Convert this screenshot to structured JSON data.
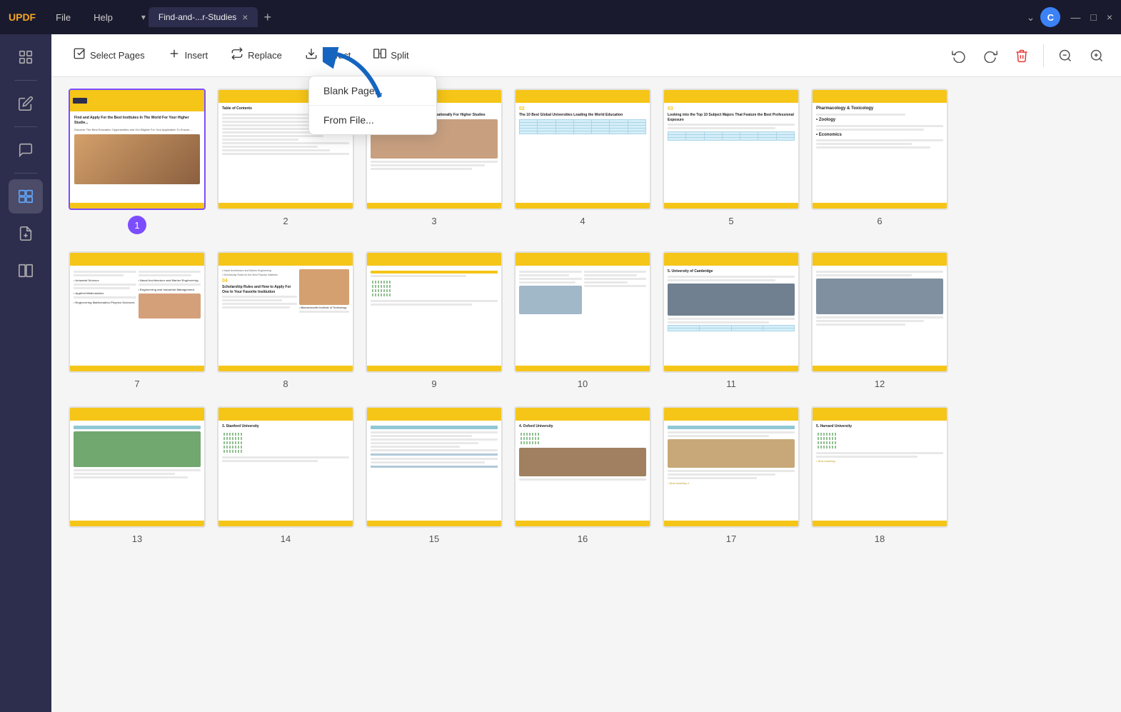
{
  "titlebar": {
    "logo": "UPDF",
    "menu_items": [
      "File",
      "Help"
    ],
    "tab_title": "Find-and-...r-Studies",
    "tab_close": "×",
    "tab_new": "+",
    "avatar_letter": "C",
    "win_btns": [
      "—",
      "□",
      "×"
    ]
  },
  "sidebar": {
    "items": [
      {
        "id": "pages",
        "icon": "⊞",
        "active": false
      },
      {
        "id": "separator1"
      },
      {
        "id": "edit",
        "icon": "✏",
        "active": false
      },
      {
        "id": "separator2"
      },
      {
        "id": "comment",
        "icon": "🖊",
        "active": false
      },
      {
        "id": "separator3"
      },
      {
        "id": "organize",
        "icon": "⊡",
        "active": true
      },
      {
        "id": "extract",
        "icon": "⊟",
        "active": false
      },
      {
        "id": "compare",
        "icon": "⊠",
        "active": false
      }
    ]
  },
  "toolbar": {
    "select_pages_label": "Select Pages",
    "insert_label": "Insert",
    "replace_label": "Replace",
    "extract_label": "Extract",
    "split_label": "Split",
    "zoom_out_icon": "zoom-out",
    "zoom_in_icon": "zoom-in",
    "rotate_left_icon": "rotate-left",
    "rotate_right_icon": "rotate-right",
    "delete_icon": "trash"
  },
  "insert_menu": {
    "items": [
      "Blank Page...",
      "From File..."
    ]
  },
  "pages": [
    {
      "num": 1,
      "selected": true
    },
    {
      "num": 2,
      "selected": false
    },
    {
      "num": 3,
      "selected": false
    },
    {
      "num": 4,
      "selected": false
    },
    {
      "num": 5,
      "selected": false
    },
    {
      "num": 6,
      "selected": false
    },
    {
      "num": 7,
      "selected": false
    },
    {
      "num": 8,
      "selected": false
    },
    {
      "num": 9,
      "selected": false
    },
    {
      "num": 10,
      "selected": false
    },
    {
      "num": 11,
      "selected": false
    },
    {
      "num": 12,
      "selected": false
    },
    {
      "num": 13,
      "selected": false
    },
    {
      "num": 14,
      "selected": false
    },
    {
      "num": 15,
      "selected": false
    },
    {
      "num": 16,
      "selected": false
    },
    {
      "num": 17,
      "selected": false
    },
    {
      "num": 18,
      "selected": false
    }
  ]
}
